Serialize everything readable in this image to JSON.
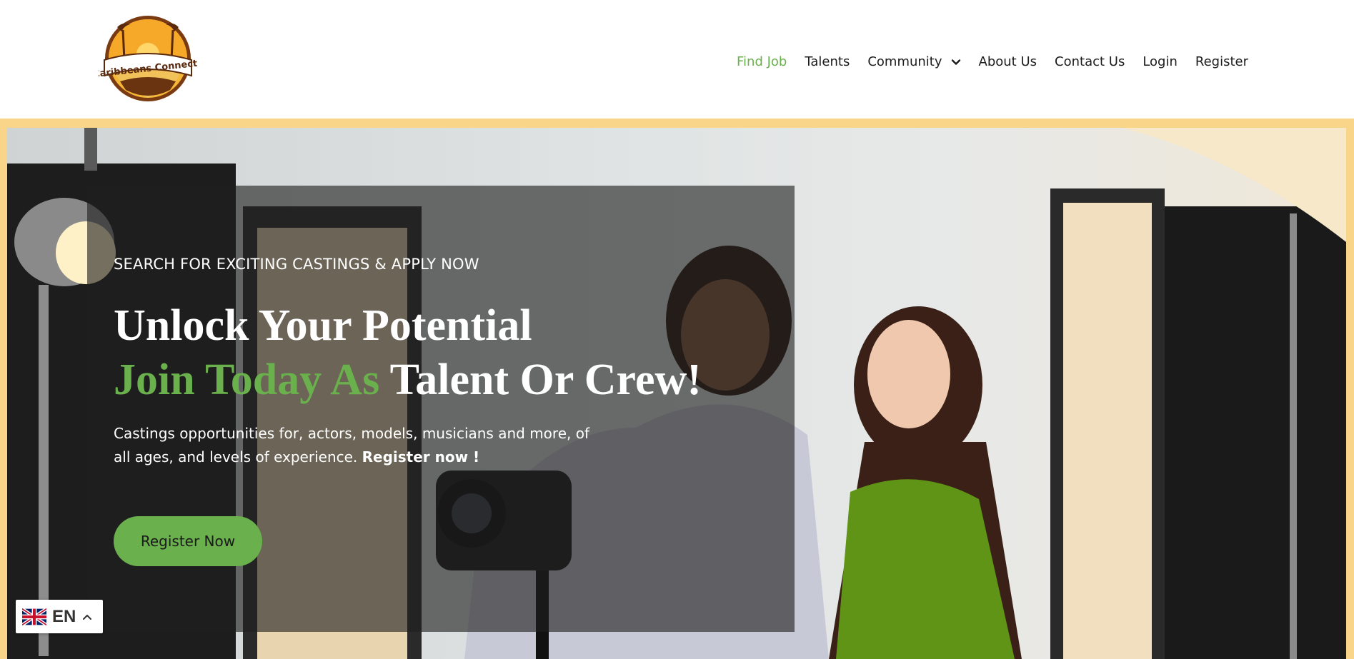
{
  "brand": {
    "logo_text": "Caribbeans Connects"
  },
  "nav": {
    "items": [
      {
        "label": "Find Job",
        "active": true
      },
      {
        "label": "Talents"
      },
      {
        "label": "Community",
        "has_dropdown": true
      },
      {
        "label": "About Us"
      },
      {
        "label": "Contact Us"
      },
      {
        "label": "Login"
      },
      {
        "label": "Register"
      }
    ]
  },
  "hero": {
    "kicker": "SEARCH FOR EXCITING CASTINGS & APPLY NOW",
    "headline_line1": "Unlock Your Potential",
    "headline_line2_green": "Join Today As",
    "headline_line2_white": "Talent Or Crew!",
    "lead_text": "Castings opportunities for, actors, models, musicians and more, of all ages, and levels of experience.",
    "lead_bold": "Register now !",
    "cta_label": "Register Now"
  },
  "language": {
    "code": "EN",
    "icon": "uk-flag-icon"
  },
  "colors": {
    "accent_green": "#6ab04c",
    "frame_yellow": "#f9d58a",
    "text_dark": "#1c1c1c"
  }
}
